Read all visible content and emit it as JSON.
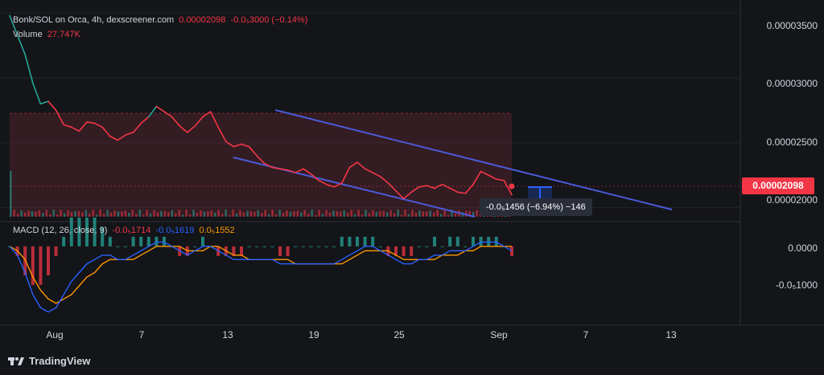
{
  "header": {
    "pair": "Bonk/SOL on Orca, 4h, dexscreener.com",
    "price": "0.00002098",
    "change": "-0.0₅3000 (−0.14%)",
    "volume_label": "Volume",
    "volume_value": "27.747K"
  },
  "macd": {
    "label": "MACD (12, 26, close, 9)",
    "hist_value": "-0.0₅1714",
    "macd_value": "-0.0₅1619",
    "signal_value": "0.0₅1552"
  },
  "price_axis": [
    "0.00003500",
    "0.00003000",
    "0.00002500",
    "0.00002000"
  ],
  "last_price": "0.00002098",
  "macd_axis": [
    "0.0000",
    "-0.0₅1000"
  ],
  "time_axis": [
    "Aug",
    "7",
    "13",
    "19",
    "25",
    "Sep",
    "7",
    "13"
  ],
  "measurement": "-0.0₅1456 (−6.94%) −146",
  "brand": "TradingView",
  "colors": {
    "up": "#26a69a",
    "down": "#f23645",
    "channel": "#4a5ad8",
    "macd_line": "#2962ff",
    "signal_line": "#ff9800"
  },
  "chart_data": [
    {
      "type": "line",
      "title": "Bonk/SOL on Orca, 4h",
      "x_ticks": [
        "Aug",
        "7",
        "13",
        "19",
        "25",
        "Sep",
        "7",
        "13"
      ],
      "ylim": [
        1.93e-05,
        3.6e-05
      ],
      "y_ticks": [
        3.5e-05,
        3e-05,
        2.5e-05,
        2e-05
      ],
      "last_price": 2.098e-05,
      "series": [
        {
          "name": "Bonk/SOL",
          "values": [
            3.48e-05,
            3.33e-05,
            3.18e-05,
            2.96e-05,
            2.8e-05,
            2.82e-05,
            2.75e-05,
            2.64e-05,
            2.62e-05,
            2.59e-05,
            2.66e-05,
            2.65e-05,
            2.62e-05,
            2.55e-05,
            2.52e-05,
            2.56e-05,
            2.58e-05,
            2.65e-05,
            2.7e-05,
            2.78e-05,
            2.74e-05,
            2.7e-05,
            2.63e-05,
            2.58e-05,
            2.63e-05,
            2.7e-05,
            2.74e-05,
            2.62e-05,
            2.51e-05,
            2.47e-05,
            2.49e-05,
            2.47e-05,
            2.4e-05,
            2.34e-05,
            2.31e-05,
            2.3e-05,
            2.29e-05,
            2.27e-05,
            2.3e-05,
            2.26e-05,
            2.21e-05,
            2.18e-05,
            2.16e-05,
            2.19e-05,
            2.31e-05,
            2.35e-05,
            2.3e-05,
            2.27e-05,
            2.24e-05,
            2.19e-05,
            2.13e-05,
            2.07e-05,
            2.12e-05,
            2.16e-05,
            2.17e-05,
            2.15e-05,
            2.18e-05,
            2.15e-05,
            2.12e-05,
            2.11e-05,
            2.18e-05,
            2.28e-05,
            2.25e-05,
            2.22e-05,
            2.21e-05,
            2.1e-05
          ]
        }
      ]
    },
    {
      "type": "line",
      "title": "MACD (12, 26, close, 9)",
      "ylim": [
        -1.8e-06,
        4e-07
      ],
      "y_ticks": [
        0,
        -1e-06
      ],
      "series": [
        {
          "name": "MACD",
          "values": [
            0.0,
            -2e-07,
            -6e-07,
            -1.1e-06,
            -1.4e-06,
            -1.5e-06,
            -1.4e-06,
            -1.1e-06,
            -8e-07,
            -6e-07,
            -4e-07,
            -3e-07,
            -2e-07,
            -2e-07,
            -3e-07,
            -3e-07,
            -2e-07,
            -1e-07,
            0.0,
            1e-07,
            1e-07,
            0.0,
            -1e-07,
            -2e-07,
            -1e-07,
            0.0,
            0.0,
            -1e-07,
            -2e-07,
            -3e-07,
            -3e-07,
            -3e-07,
            -3e-07,
            -3e-07,
            -3e-07,
            -4e-07,
            -4e-07,
            -4e-07,
            -4e-07,
            -4e-07,
            -4e-07,
            -4e-07,
            -4e-07,
            -3e-07,
            -2e-07,
            -1e-07,
            0.0,
            0.0,
            -1e-07,
            -2e-07,
            -3e-07,
            -4e-07,
            -4e-07,
            -3e-07,
            -3e-07,
            -2e-07,
            -2e-07,
            -1e-07,
            -1e-07,
            -1e-07,
            0.0,
            1e-07,
            1e-07,
            1e-07,
            0.0,
            -1e-07
          ]
        },
        {
          "name": "Signal",
          "values": [
            0.0,
            -1e-07,
            -3e-07,
            -7e-07,
            -1e-06,
            -1.2e-06,
            -1.3e-06,
            -1.2e-06,
            -1.1e-06,
            -9e-07,
            -7e-07,
            -6e-07,
            -4e-07,
            -3e-07,
            -3e-07,
            -3e-07,
            -3e-07,
            -2e-07,
            -1e-07,
            0.0,
            0.0,
            0.0,
            0.0,
            -1e-07,
            -1e-07,
            -1e-07,
            0.0,
            0.0,
            -1e-07,
            -2e-07,
            -2e-07,
            -3e-07,
            -3e-07,
            -3e-07,
            -3e-07,
            -3e-07,
            -3e-07,
            -4e-07,
            -4e-07,
            -4e-07,
            -4e-07,
            -4e-07,
            -4e-07,
            -4e-07,
            -3e-07,
            -2e-07,
            -1e-07,
            -1e-07,
            -1e-07,
            -1e-07,
            -2e-07,
            -3e-07,
            -3e-07,
            -3e-07,
            -3e-07,
            -3e-07,
            -2e-07,
            -2e-07,
            -2e-07,
            -1e-07,
            -1e-07,
            0.0,
            0.0,
            0.0,
            0.0,
            0.0
          ]
        }
      ]
    }
  ]
}
